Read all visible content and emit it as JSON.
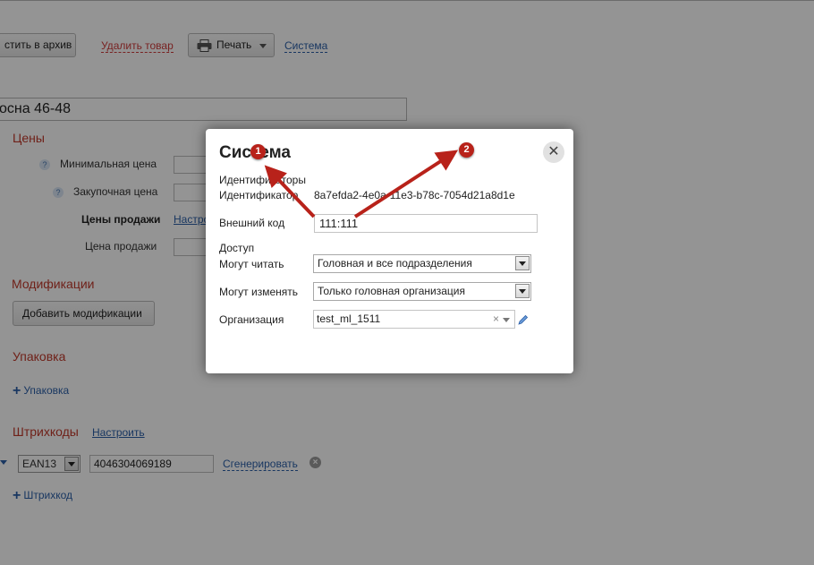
{
  "toolbar": {
    "archive_label": "стить в архив",
    "delete_label": "Удалить товар",
    "print_label": "Печать",
    "system_label": "Система"
  },
  "product": {
    "name": "осна 46-48"
  },
  "prices": {
    "title": "Цены",
    "min_price_label": "Минимальная цена",
    "purchase_price_label": "Закупочная цена",
    "sale_prices_label": "Цены продажи",
    "sale_prices_link": "Настро",
    "sale_price_label": "Цена продажи",
    "help_glyph": "?"
  },
  "modifications": {
    "title": "Модификации",
    "add_button": "Добавить модификации"
  },
  "packaging": {
    "title": "Упаковка",
    "add_link": "Упаковка"
  },
  "barcodes": {
    "title": "Штрихкоды",
    "configure_link": "Настроить",
    "type_value": "EAN13",
    "code_value": "4046304069189",
    "generate_link": "Сгенерировать",
    "add_link": "Штрихкод"
  },
  "modal": {
    "title": "Система",
    "close_glyph": "✕",
    "identifiers_heading": "Идентификаторы",
    "identifier_label": "Идентификатор",
    "identifier_value": "8a7efda2-4e0a-11e3-b78c-7054d21a8d1e",
    "external_code_label": "Внешний код",
    "external_code_value": "111:111",
    "access_heading": "Доступ",
    "can_read_label": "Могут читать",
    "can_read_value": "Головная и все подразделения",
    "can_edit_label": "Могут изменять",
    "can_edit_value": "Только головная организация",
    "organization_label": "Организация",
    "organization_value": "test_ml_1511",
    "clear_glyph": "×"
  },
  "annotations": {
    "badge1": "1",
    "badge2": "2",
    "color": "#b8221a"
  }
}
